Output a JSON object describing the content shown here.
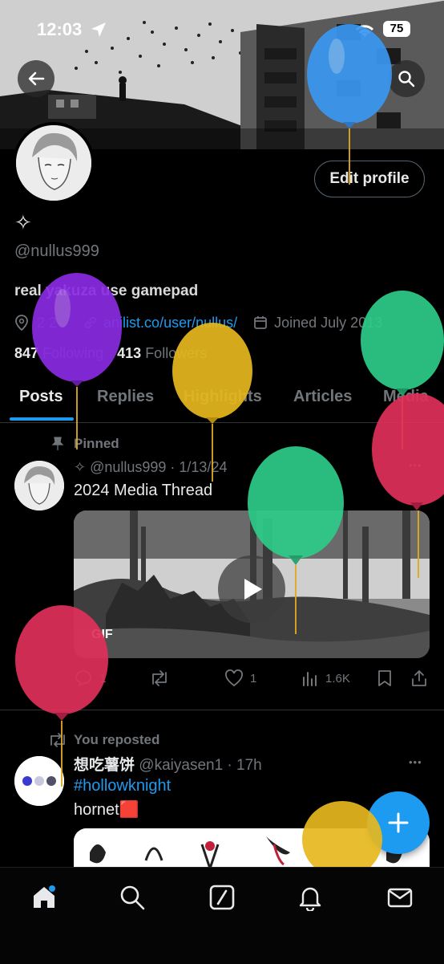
{
  "status_bar": {
    "time": "12:03",
    "battery": "75"
  },
  "profile": {
    "display_name": "✧",
    "handle": "@nullus999",
    "bio": "real yakuza use gamepad",
    "location": "2 2",
    "website": "anilist.co/user/nullus/",
    "joined": "Joined July 2013",
    "following_count": "847",
    "following_label": "Following",
    "followers_count": "413",
    "followers_label": "Followers",
    "edit_button": "Edit profile"
  },
  "tabs": [
    "Posts",
    "Replies",
    "Highlights",
    "Articles",
    "Media"
  ],
  "pinned_post": {
    "pinned_label": "Pinned",
    "author": "✧ @nullus999 · 1/13/24",
    "text": "2024 Media Thread",
    "media_badge": "GIF",
    "replies": "1",
    "likes": "1",
    "views": "1.6K"
  },
  "repost": {
    "repost_label": "You reposted",
    "author_name": "想吃薯饼",
    "author_handle_time": "@kaiyasen1 · 17h",
    "hashtag": "#hollowknight",
    "text": "hornet🟥"
  },
  "more_glyph": "•••",
  "colors": {
    "accent": "#1d9bf0",
    "balloon_blue": "#3a97f0",
    "balloon_purple": "#8a2be2",
    "balloon_yellow": "#e6b91e",
    "balloon_green": "#2ecc8a",
    "balloon_red": "#e0305a"
  }
}
